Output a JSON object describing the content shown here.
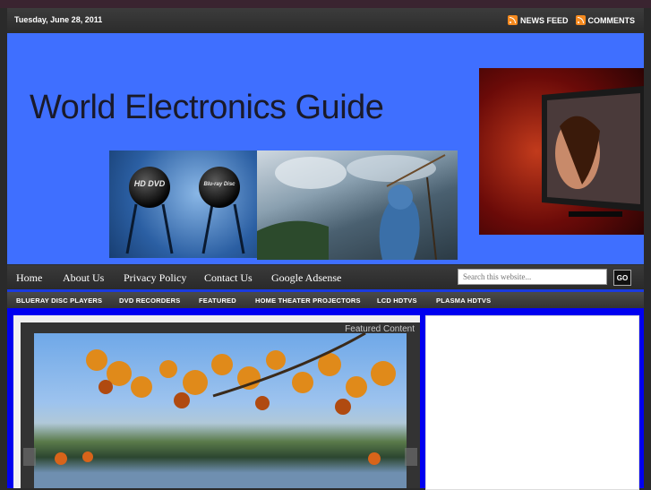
{
  "topbar": {
    "date": "Tuesday, June 28, 2011",
    "news_feed": "NEWS FEED",
    "comments": "COMMENTS"
  },
  "header": {
    "title": "World Electronics Guide",
    "disc1": "HD DVD",
    "disc2": "Blu-ray Disc"
  },
  "nav": {
    "items": [
      "Home",
      "About Us",
      "Privacy Policy",
      "Contact Us",
      "Google Adsense"
    ],
    "search_placeholder": "Search this website...",
    "go_label": "GO"
  },
  "categories": [
    "BLUERAY DISC PLAYERS",
    "DVD RECORDERS",
    "FEATURED",
    "HOME THEATER PROJECTORS",
    "LCD HDTVS",
    "PLASMA HDTVS"
  ],
  "featured": {
    "label": "Featured Content"
  },
  "colors": {
    "header_bg": "#3f6fff",
    "main_bg": "#0000f0",
    "accent_rss": "#f58a1f"
  }
}
